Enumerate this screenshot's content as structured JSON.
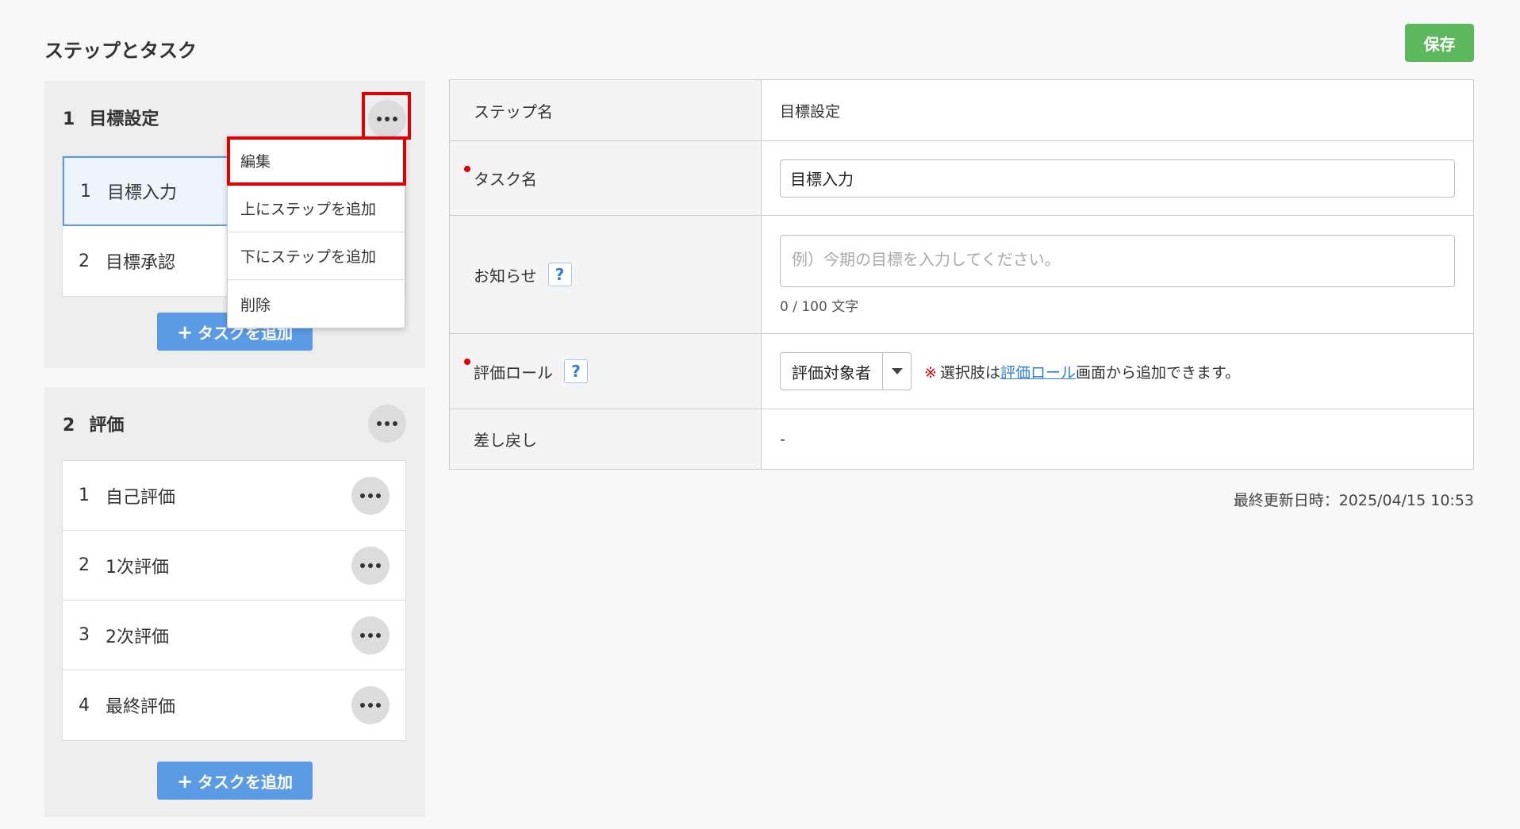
{
  "page": {
    "title": "ステップとタスク",
    "save_label": "保存"
  },
  "steps": [
    {
      "num": "1",
      "name": "目標設定",
      "tasks": [
        {
          "num": "1",
          "name": "目標入力"
        },
        {
          "num": "2",
          "name": "目標承認"
        }
      ],
      "add_task_label": "タスクを追加"
    },
    {
      "num": "2",
      "name": "評価",
      "tasks": [
        {
          "num": "1",
          "name": "自己評価"
        },
        {
          "num": "2",
          "name": "1次評価"
        },
        {
          "num": "3",
          "name": "2次評価"
        },
        {
          "num": "4",
          "name": "最終評価"
        }
      ],
      "add_task_label": "タスクを追加"
    }
  ],
  "context_menu": {
    "items": [
      "編集",
      "上にステップを追加",
      "下にステップを追加",
      "削除"
    ]
  },
  "form": {
    "step_name_label": "ステップ名",
    "step_name_value": "目標設定",
    "task_name_label": "タスク名",
    "task_name_value": "目標入力",
    "notice_label": "お知らせ",
    "notice_placeholder": "例）今期の目標を入力してください。",
    "notice_counter": "0 / 100 文字",
    "role_label": "評価ロール",
    "role_value": "評価対象者",
    "role_note_mark": "※",
    "role_note_pre": "選択肢は",
    "role_note_link": "評価ロール",
    "role_note_post": "画面から追加できます。",
    "sendback_label": "差し戻し",
    "sendback_value": "-",
    "help_glyph": "?"
  },
  "last_updated": "最終更新日時：2025/04/15 10:53",
  "colors": {
    "save_button": "#5cb85c",
    "add_task_button": "#5b9be6",
    "highlight": "#e00000",
    "link": "#2f7fd8"
  },
  "icons": {
    "more": "more-horizontal-icon",
    "help": "help-icon",
    "add": "plus-icon",
    "dropdown": "caret-down-icon"
  }
}
